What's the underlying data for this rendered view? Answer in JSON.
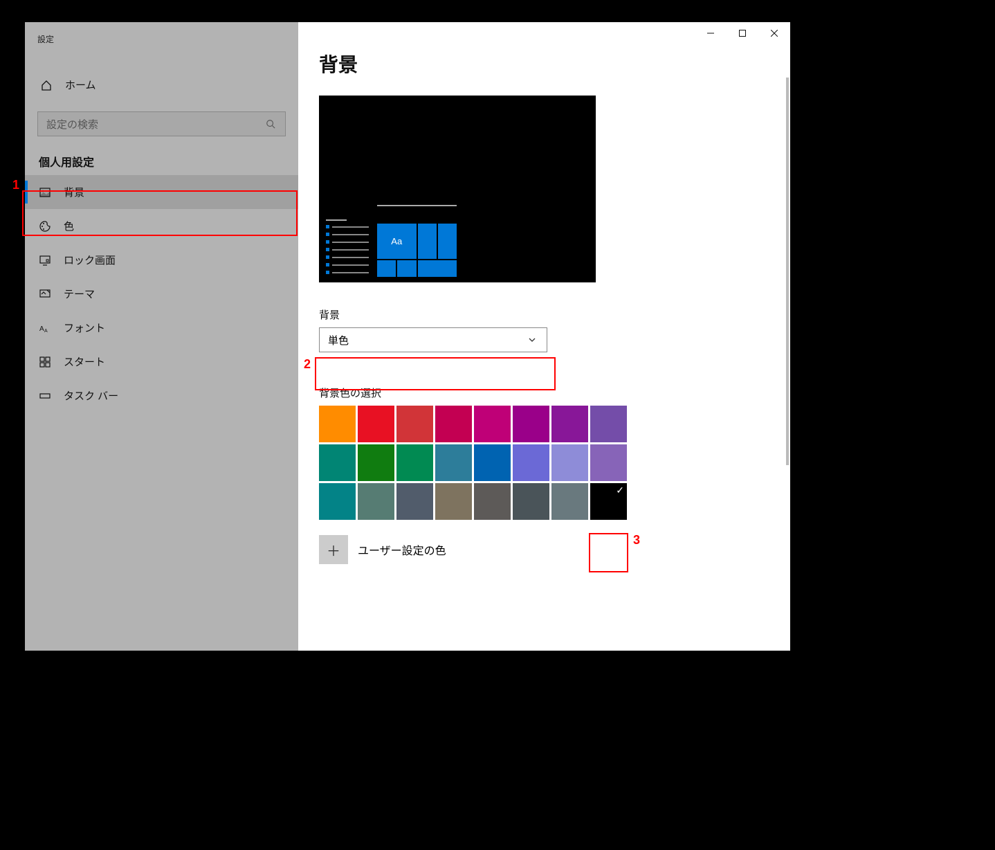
{
  "window": {
    "title": "設定",
    "controls": {
      "minimize": "─",
      "maximize": "☐",
      "close": "✕"
    }
  },
  "sidebar": {
    "home_label": "ホーム",
    "search_placeholder": "設定の検索",
    "category_label": "個人用設定",
    "items": [
      {
        "label": "背景",
        "active": true
      },
      {
        "label": "色",
        "active": false
      },
      {
        "label": "ロック画面",
        "active": false
      },
      {
        "label": "テーマ",
        "active": false
      },
      {
        "label": "フォント",
        "active": false
      },
      {
        "label": "スタート",
        "active": false
      },
      {
        "label": "タスク バー",
        "active": false
      }
    ]
  },
  "main": {
    "heading": "背景",
    "preview_sample_text": "Aa",
    "background_field_label": "背景",
    "background_dropdown_value": "単色",
    "color_section_label": "背景色の選択",
    "colors": [
      "#ff8c00",
      "#e81123",
      "#d13438",
      "#c30052",
      "#bf0077",
      "#9a0089",
      "#881798",
      "#744da9",
      "#018574",
      "#107c10",
      "#018a52",
      "#2d7d9a",
      "#0063b1",
      "#6b69d6",
      "#8e8cd8",
      "#8764b8",
      "#038387",
      "#567c73",
      "#515c6b",
      "#7e735f",
      "#5d5a58",
      "#4a5459",
      "#69797e",
      "#000000"
    ],
    "selected_color_index": 23,
    "custom_color_label": "ユーザー設定の色",
    "custom_color_button_glyph": "＋"
  },
  "annotations": {
    "m1": "1",
    "m2": "2",
    "m3": "3"
  }
}
